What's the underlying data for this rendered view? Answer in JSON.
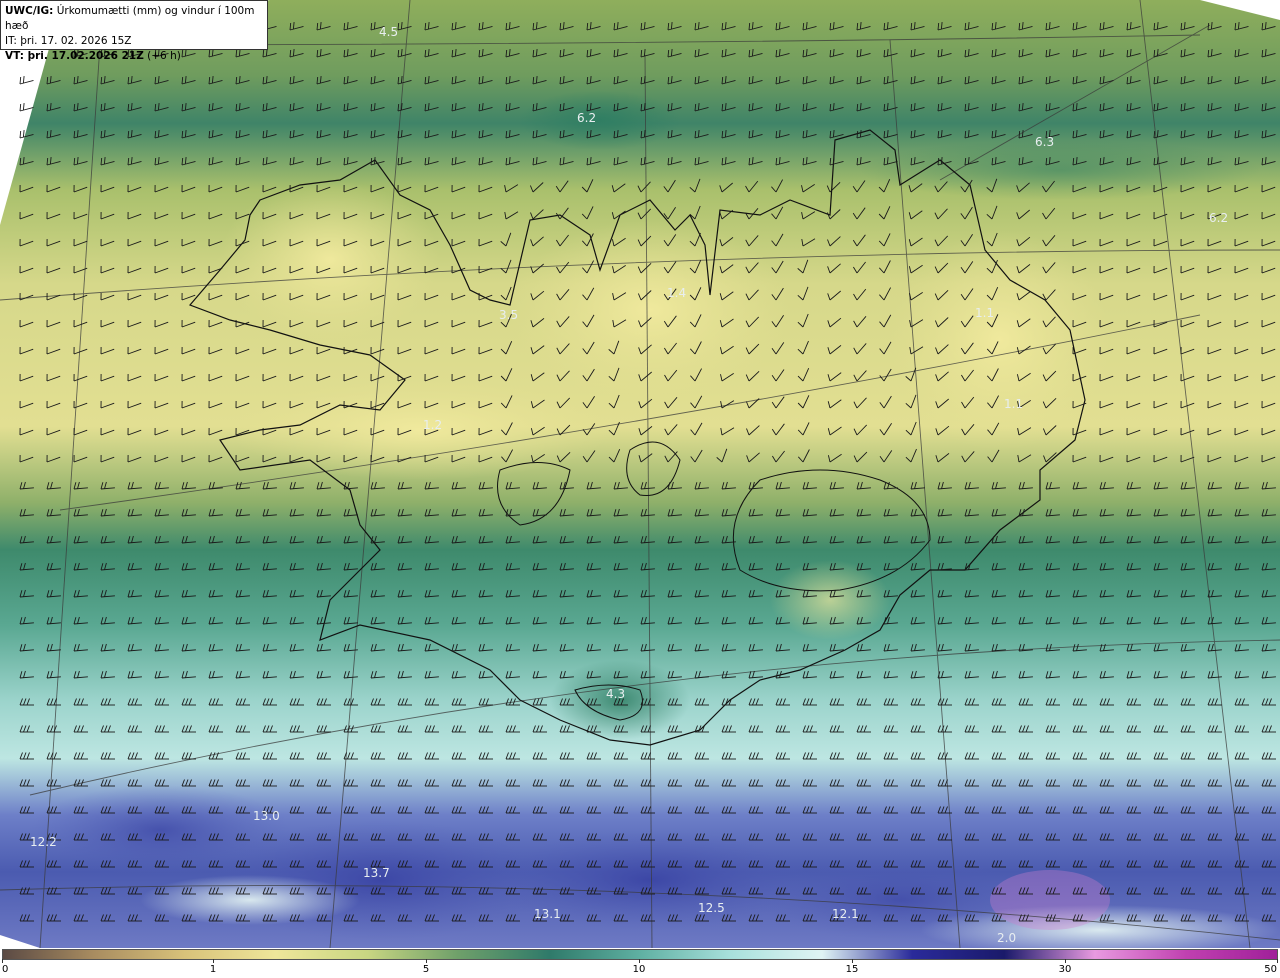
{
  "header": {
    "model": "UWC/IG:",
    "field": "Úrkomumætti (mm) og vindur í 100m hæð",
    "it_line": "IT: þri. 17. 02. 2026 15Z",
    "vt_label": "VT: þri. 17.02.2026 21Z",
    "vt_offset": "(+6 h)"
  },
  "colorbar": {
    "ticks": [
      "0",
      "1",
      "5",
      "10",
      "15",
      "30",
      "50"
    ],
    "colors": [
      "#5b4a44",
      "#a88c60",
      "#d8c27a",
      "#eee69a",
      "#c8d682",
      "#6fa06a",
      "#2f7a6a",
      "#5fb0a2",
      "#a8e0dc",
      "#e0f4f4",
      "#2a2a9a",
      "#1a1a6a",
      "#e89ae0",
      "#c040b0",
      "#a0209a"
    ]
  },
  "map": {
    "value_labels": [
      "4.5",
      "6.2",
      "6.3",
      "6.2",
      "3.5",
      "1.4",
      "1.1",
      "1.1",
      "1.2",
      "4.3",
      "13.0",
      "12.2",
      "13.7",
      "13.1",
      "12.5",
      "12.1",
      "2.0"
    ]
  }
}
